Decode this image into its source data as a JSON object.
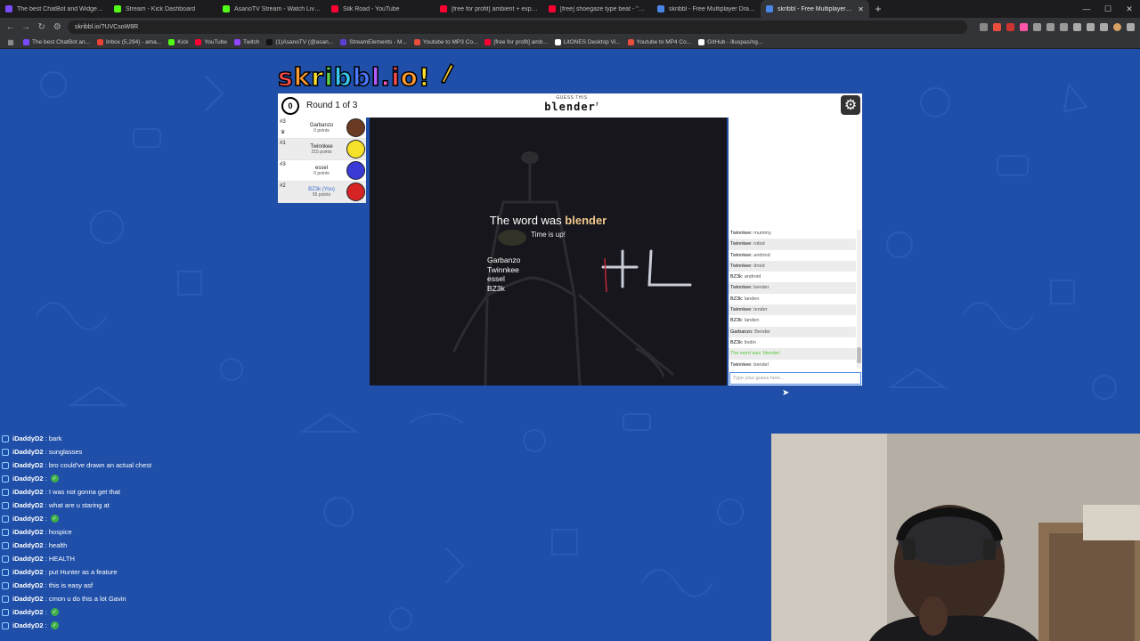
{
  "browser": {
    "tabs": [
      {
        "label": "The best ChatBot and Widgets for K",
        "color": "#7a4cff",
        "active": false
      },
      {
        "label": "Stream - Kick Dashboard",
        "color": "#53fc18",
        "active": false
      },
      {
        "label": "AsanoTV Stream - Watch Live on Kick",
        "color": "#53fc18",
        "active": false
      },
      {
        "label": "Silk Road - YouTube",
        "color": "#ff0033",
        "active": false
      },
      {
        "label": "[free for profit] ambient + experimen",
        "color": "#ff0033",
        "active": false
      },
      {
        "label": "[free] shoegaze type beat - \"Aband",
        "color": "#ff0033",
        "active": false
      },
      {
        "label": "skribbl - Free Multiplayer Drawing &",
        "color": "#4a86e8",
        "active": false
      },
      {
        "label": "skribbl - Free Multiplayer Dr",
        "color": "#4a86e8",
        "active": true
      }
    ],
    "url": "skribbl.io/?UVCsoW8R",
    "bookmarks": [
      {
        "label": "The best ChatBot an...",
        "color": "#7a4cff"
      },
      {
        "label": "Inbox (5,294) - ama...",
        "color": "#ea4335"
      },
      {
        "label": "Kick",
        "color": "#53fc18"
      },
      {
        "label": "YouTube",
        "color": "#ff0033"
      },
      {
        "label": "Twitch",
        "color": "#9146ff"
      },
      {
        "label": "(1)AsanoTV (@asan...",
        "color": "#111111"
      },
      {
        "label": "StreamElements - M...",
        "color": "#5d3fd3"
      },
      {
        "label": "Youtube to MP3 Co...",
        "color": "#e94d3c"
      },
      {
        "label": "[free for profit] amb...",
        "color": "#ff0033"
      },
      {
        "label": "LitONES Desktop Vi...",
        "color": "#ffffff"
      },
      {
        "label": "Youtube to MP4 Co...",
        "color": "#e94d3c"
      },
      {
        "label": "GitHub - illuspas/ng...",
        "color": "#ffffff"
      }
    ]
  },
  "game": {
    "round_label": "Round 1 of 3",
    "timer": "0",
    "guess_this_label": "GUESS THIS",
    "word": "blender",
    "word_length": "7",
    "players": [
      {
        "rank": "#3",
        "name": "Garbanzo",
        "points": "0 points",
        "avatar_color": "#6b3a22",
        "you": false,
        "crown": true
      },
      {
        "rank": "#1",
        "name": "Twinnkee",
        "points": "215 points",
        "avatar_color": "#f5e12a",
        "you": false,
        "crown": false
      },
      {
        "rank": "#3",
        "name": "essel",
        "points": "0 points",
        "avatar_color": "#3a3ad6",
        "you": false,
        "crown": false
      },
      {
        "rank": "#2",
        "name": "BZ3k (You)",
        "points": "55 points",
        "avatar_color": "#d62424",
        "you": true,
        "crown": false
      }
    ],
    "overlay": {
      "title_prefix": "The word was",
      "title_word": "blender",
      "subtitle": "Time is up!",
      "names": [
        "Garbanzo",
        "Twinnkee",
        "essel",
        "BZ3k"
      ]
    },
    "chat": [
      {
        "user": "Twinnkee:",
        "text": "mummy"
      },
      {
        "user": "Twinnkee:",
        "text": "robot"
      },
      {
        "user": "Twinnkee:",
        "text": "andriod"
      },
      {
        "user": "Twinnkee:",
        "text": "droid"
      },
      {
        "user": "BZ3k:",
        "text": "android"
      },
      {
        "user": "Twinnkee:",
        "text": "bender"
      },
      {
        "user": "BZ3k:",
        "text": "landen"
      },
      {
        "user": "Twinnkee:",
        "text": "lender"
      },
      {
        "user": "BZ3k:",
        "text": "landen"
      },
      {
        "user": "Garbanzo:",
        "text": "Bender"
      },
      {
        "user": "BZ3k:",
        "text": "lindin"
      },
      {
        "system": "The word was 'blender'"
      },
      {
        "user": "Twinnkee:",
        "text": "bendel"
      }
    ],
    "guess_placeholder": "Type your guess here..."
  },
  "stream_chat": [
    {
      "user": "iDaddyD2",
      "text": ": bark",
      "emote": false
    },
    {
      "user": "iDaddyD2",
      "text": ": sunglasses",
      "emote": false
    },
    {
      "user": "iDaddyD2",
      "text": ": bro could've drawn an actual chest",
      "emote": false
    },
    {
      "user": "iDaddyD2",
      "text": ":",
      "emote": true
    },
    {
      "user": "iDaddyD2",
      "text": ": I was not gonna get that",
      "emote": false
    },
    {
      "user": "iDaddyD2",
      "text": ": what are u staring at",
      "emote": false
    },
    {
      "user": "iDaddyD2",
      "text": ":",
      "emote": true
    },
    {
      "user": "iDaddyD2",
      "text": ": hospice",
      "emote": false
    },
    {
      "user": "iDaddyD2",
      "text": ": health",
      "emote": false
    },
    {
      "user": "iDaddyD2",
      "text": ": HEALTH",
      "emote": false
    },
    {
      "user": "iDaddyD2",
      "text": ": put Hunter as a feature",
      "emote": false
    },
    {
      "user": "iDaddyD2",
      "text": ": this is easy asf",
      "emote": false
    },
    {
      "user": "iDaddyD2",
      "text": ": cmon u do this a lot Gavin",
      "emote": false
    },
    {
      "user": "iDaddyD2",
      "text": ":",
      "emote": true
    },
    {
      "user": "iDaddyD2",
      "text": ":",
      "emote": true
    }
  ]
}
